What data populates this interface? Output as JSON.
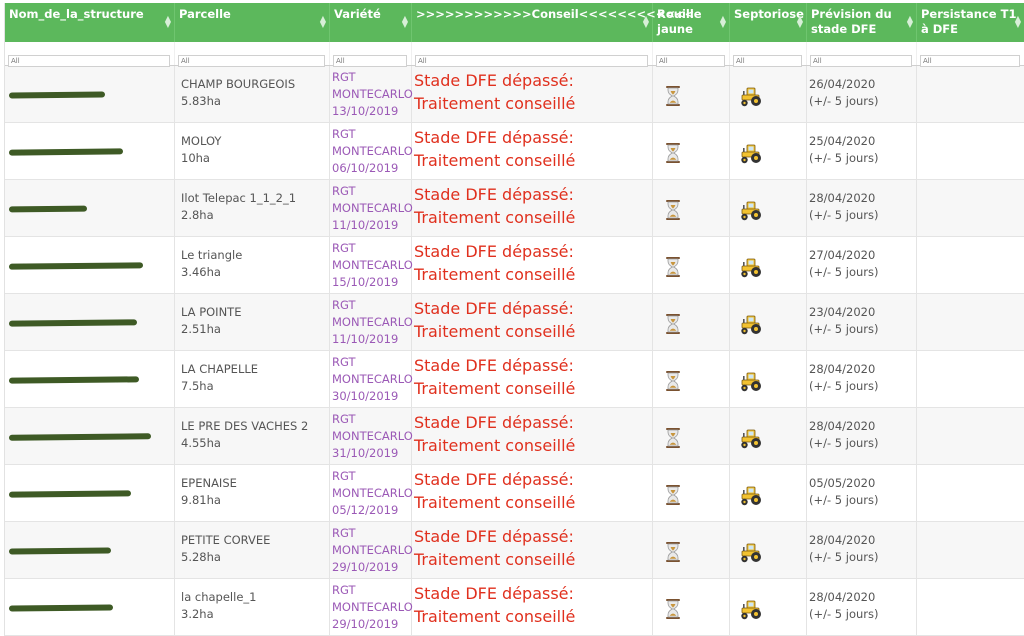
{
  "columns": [
    {
      "label": "Nom_de_la_structure",
      "filter": "All"
    },
    {
      "label": "Parcelle",
      "filter": "All"
    },
    {
      "label": "Variété",
      "filter": "All"
    },
    {
      "label": ">>>>>>>>>>>>Conseil<<<<<<<<<<<<",
      "filter": "All"
    },
    {
      "label": "Rouille jaune",
      "filter": "All"
    },
    {
      "label": "Septoriose",
      "filter": "All"
    },
    {
      "label": "Prévision du stade DFE",
      "filter": "All"
    },
    {
      "label": "Persistance T1 à DFE",
      "filter": "All"
    }
  ],
  "icons": {
    "rouille": "hourglass-icon",
    "septoriose": "tractor-icon"
  },
  "colors": {
    "header": "#5cb85c",
    "variety": "#9b59b6",
    "advice": "#e0301e",
    "redaction": "#3e5a25"
  },
  "rows": [
    {
      "parcel": "CHAMP BOURGEOIS",
      "area": "5.83ha",
      "variety": "RGT MONTECARLO",
      "sowing": "13/10/2019",
      "advice": "Stade DFE dépassé: Traitement conseillé",
      "forecast": "26/04/2020",
      "margin": "(+/- 5 jours)"
    },
    {
      "parcel": "MOLOY",
      "area": "10ha",
      "variety": "RGT MONTECARLO",
      "sowing": "06/10/2019",
      "advice": "Stade DFE dépassé: Traitement conseillé",
      "forecast": "25/04/2020",
      "margin": "(+/- 5 jours)"
    },
    {
      "parcel": "Ilot Telepac 1_1_2_1",
      "area": "2.8ha",
      "variety": "RGT MONTECARLO",
      "sowing": "11/10/2019",
      "advice": "Stade DFE dépassé: Traitement conseillé",
      "forecast": "28/04/2020",
      "margin": "(+/- 5 jours)"
    },
    {
      "parcel": "Le triangle",
      "area": "3.46ha",
      "variety": "RGT MONTECARLO",
      "sowing": "15/10/2019",
      "advice": "Stade DFE dépassé: Traitement conseillé",
      "forecast": "27/04/2020",
      "margin": "(+/- 5 jours)"
    },
    {
      "parcel": "LA POINTE",
      "area": "2.51ha",
      "variety": "RGT MONTECARLO",
      "sowing": "11/10/2019",
      "advice": "Stade DFE dépassé: Traitement conseillé",
      "forecast": "23/04/2020",
      "margin": "(+/- 5 jours)"
    },
    {
      "parcel": "LA CHAPELLE",
      "area": "7.5ha",
      "variety": "RGT MONTECARLO",
      "sowing": "30/10/2019",
      "advice": "Stade DFE dépassé: Traitement conseillé",
      "forecast": "28/04/2020",
      "margin": "(+/- 5 jours)"
    },
    {
      "parcel": "LE PRE DES VACHES 2",
      "area": "4.55ha",
      "variety": "RGT MONTECARLO",
      "sowing": "31/10/2019",
      "advice": "Stade DFE dépassé: Traitement conseillé",
      "forecast": "28/04/2020",
      "margin": "(+/- 5 jours)"
    },
    {
      "parcel": "EPENAISE",
      "area": "9.81ha",
      "variety": "RGT MONTECARLO",
      "sowing": "05/12/2019",
      "advice": "Stade DFE dépassé: Traitement conseillé",
      "forecast": "05/05/2020",
      "margin": "(+/- 5 jours)"
    },
    {
      "parcel": "PETITE CORVEE",
      "area": "5.28ha",
      "variety": "RGT MONTECARLO",
      "sowing": "29/10/2019",
      "advice": "Stade DFE dépassé: Traitement conseillé",
      "forecast": "28/04/2020",
      "margin": "(+/- 5 jours)"
    },
    {
      "parcel": "la chapelle_1",
      "area": "3.2ha",
      "variety": "RGT MONTECARLO",
      "sowing": "29/10/2019",
      "advice": "Stade DFE dépassé: Traitement conseillé",
      "forecast": "28/04/2020",
      "margin": "(+/- 5 jours)"
    }
  ]
}
